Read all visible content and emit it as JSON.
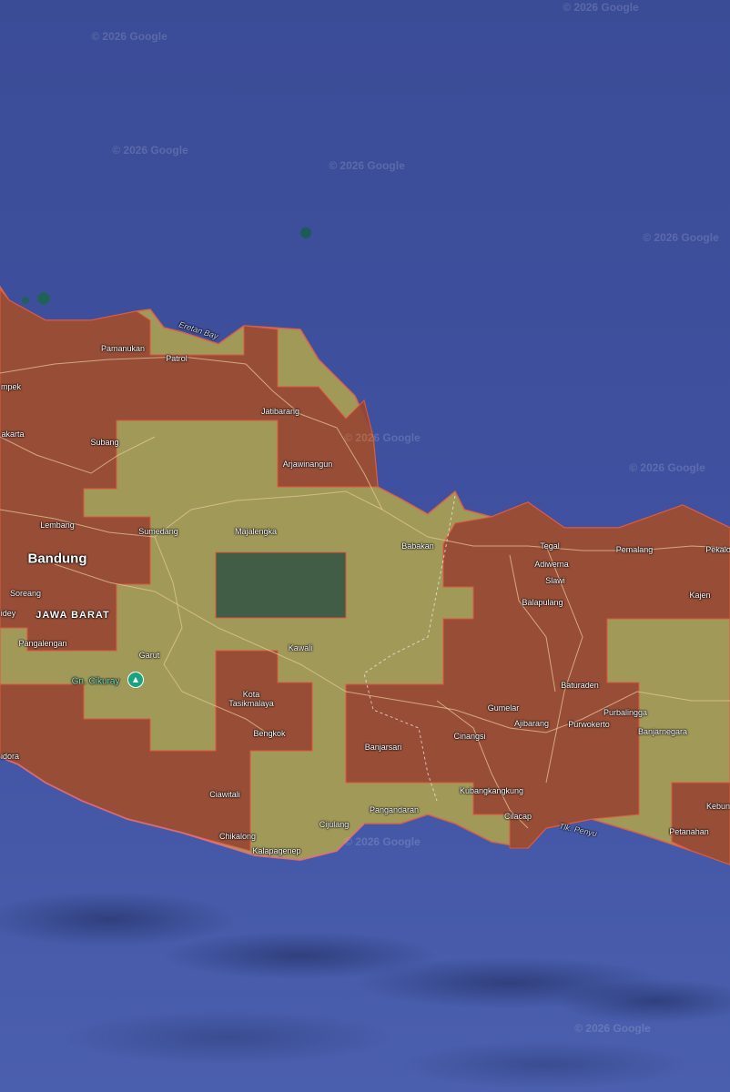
{
  "map": {
    "watermarks": [
      "© 2026 Google",
      "© 2026 Google",
      "© 2026 Google",
      "© 2026 Google",
      "© 2026 Google",
      "© 2026 Google",
      "© 2026 Google",
      "© 2026 Google",
      "© 2026 Google"
    ],
    "water_labels": [
      "Eretan Bay",
      "Tlk. Penyu"
    ],
    "cities": [
      "Bandung"
    ],
    "regions": [
      "JAWA BARAT"
    ],
    "poi": {
      "label": "Gn. Cikuray",
      "icon": "mountain-icon"
    },
    "places": [
      "Pamanukan",
      "Patrol",
      "Jatibarang",
      "Subang",
      "Arjawinangun",
      "Lembang",
      "Sumedang",
      "Majalengka",
      "Soreang",
      "Pangalengan",
      "Garut",
      "Kawali",
      "Kota Tasikmalaya",
      "Bengkok",
      "Ciawitali",
      "Chikalong",
      "Kalapagenep",
      "Cijulang",
      "Pangandaran",
      "Banjarsari",
      "Cinangsi",
      "Gumelar",
      "Ajibarang",
      "Purwokerto",
      "Purbalingga",
      "Banjarnegara",
      "Kubangkangkung",
      "Cilacap",
      "Babakan",
      "Tegal",
      "Adiwerna",
      "Slawi",
      "Balapulang",
      "Baturaden",
      "Pemalang",
      "Kajen",
      "Petanahan",
      "mpek",
      "akarta",
      "idey",
      "idora",
      "Pekalo",
      "Kebun"
    ]
  },
  "colors": {
    "sea": "#3e4f9a",
    "overlay_red": "#9a4a35",
    "overlay_yellow": "#a39a5a",
    "boundary": "#d9553b",
    "roads": "#e6c79a"
  }
}
